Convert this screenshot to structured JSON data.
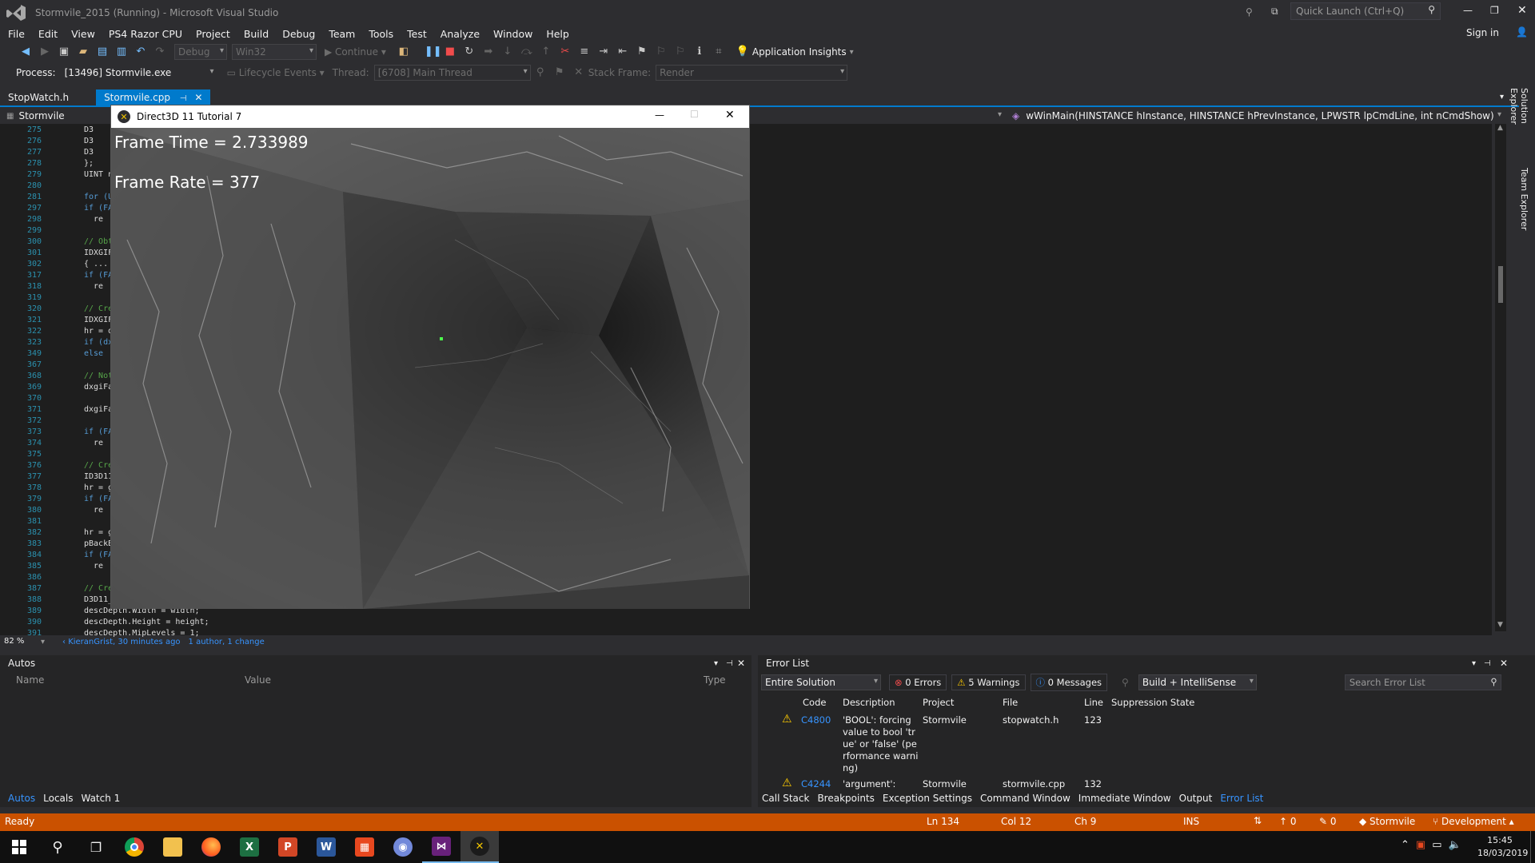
{
  "window": {
    "title": "Stormvile_2015 (Running) - Microsoft Visual Studio",
    "quick_launch": "Quick Launch (Ctrl+Q)",
    "sign_in": "Sign in"
  },
  "menu": [
    "File",
    "Edit",
    "View",
    "PS4 Razor CPU",
    "Project",
    "Build",
    "Debug",
    "Team",
    "Tools",
    "Test",
    "Analyze",
    "Window",
    "Help"
  ],
  "toolbar": {
    "config": "Debug",
    "platform": "Win32",
    "continue": "Continue",
    "app_insights": "Application Insights"
  },
  "debugbar": {
    "process_label": "Process:",
    "process": "[13496] Stormvile.exe",
    "lifecycle": "Lifecycle Events",
    "thread_label": "Thread:",
    "thread": "[6708] Main Thread",
    "stack_label": "Stack Frame:",
    "stack": "Render"
  },
  "tabs": [
    {
      "label": "StopWatch.h"
    },
    {
      "label": "Stormvile.cpp"
    }
  ],
  "nav": {
    "project": "Stormvile",
    "function": "wWinMain(HINSTANCE hInstance, HINSTANCE hPrevInstance, LPWSTR lpCmdLine, int nCmdShow)"
  },
  "side_tabs": [
    "Solution Explorer",
    "Team Explorer"
  ],
  "editor": {
    "lines": [
      {
        "n": "275",
        "c": "D3"
      },
      {
        "n": "276",
        "c": "D3"
      },
      {
        "n": "277",
        "c": "D3"
      },
      {
        "n": "278",
        "c": "};"
      },
      {
        "n": "279",
        "c": "UINT n"
      },
      {
        "n": "280",
        "c": ""
      },
      {
        "n": "281",
        "c": "for (U"
      },
      {
        "n": "297",
        "c": "if (FA"
      },
      {
        "n": "298",
        "c": "  re"
      },
      {
        "n": "299",
        "c": ""
      },
      {
        "n": "300",
        "c": "// Obt"
      },
      {
        "n": "301",
        "c": "IDXGIF"
      },
      {
        "n": "302",
        "c": "{ ..."
      },
      {
        "n": "317",
        "c": "if (FA"
      },
      {
        "n": "318",
        "c": "  re"
      },
      {
        "n": "319",
        "c": ""
      },
      {
        "n": "320",
        "c": "// Cre"
      },
      {
        "n": "321",
        "c": "IDXGIF"
      },
      {
        "n": "322",
        "c": "hr = d"
      },
      {
        "n": "323",
        "c": "if (dx"
      },
      {
        "n": "349",
        "c": "else"
      },
      {
        "n": "367",
        "c": ""
      },
      {
        "n": "368",
        "c": "// Not"
      },
      {
        "n": "369",
        "c": "dxgiFa"
      },
      {
        "n": "370",
        "c": ""
      },
      {
        "n": "371",
        "c": "dxgiFa"
      },
      {
        "n": "372",
        "c": ""
      },
      {
        "n": "373",
        "c": "if (FA"
      },
      {
        "n": "374",
        "c": "  re"
      },
      {
        "n": "375",
        "c": ""
      },
      {
        "n": "376",
        "c": "// Cre"
      },
      {
        "n": "377",
        "c": "ID3D11"
      },
      {
        "n": "378",
        "c": "hr = g"
      },
      {
        "n": "379",
        "c": "if (FA"
      },
      {
        "n": "380",
        "c": "  re"
      },
      {
        "n": "381",
        "c": ""
      },
      {
        "n": "382",
        "c": "hr = g"
      },
      {
        "n": "383",
        "c": "pBackB"
      },
      {
        "n": "384",
        "c": "if (FA"
      },
      {
        "n": "385",
        "c": "  re"
      },
      {
        "n": "386",
        "c": ""
      },
      {
        "n": "387",
        "c": "// Cre"
      },
      {
        "n": "388",
        "c": "D3D11_"
      },
      {
        "n": "389",
        "c": "descDepth.Width = width;"
      },
      {
        "n": "390",
        "c": "descDepth.Height = height;"
      },
      {
        "n": "391",
        "c": "descDepth.MipLevels = 1;"
      }
    ],
    "zoom": "82 %",
    "codelens_author": "KieranGrist, 30 minutes ago",
    "codelens_changes": "1 author, 1 change"
  },
  "dx_window": {
    "title": "Direct3D 11 Tutorial 7",
    "frame_time": "Frame Time = 2.733989",
    "frame_rate": "Frame Rate = 377"
  },
  "autos": {
    "title": "Autos",
    "col_name": "Name",
    "col_value": "Value",
    "col_type": "Type"
  },
  "error_list": {
    "title": "Error List",
    "scope": "Entire Solution",
    "errors": "0 Errors",
    "warnings": "5 Warnings",
    "messages": "0 Messages",
    "build_filter": "Build + IntelliSense",
    "search": "Search Error List",
    "cols": [
      "Code",
      "Description",
      "Project",
      "File",
      "Line",
      "Suppression State"
    ],
    "rows": [
      {
        "code": "C4800",
        "desc": "'BOOL': forcing value to bool 'true' or 'false' (performance warning)",
        "project": "Stormvile",
        "file": "stopwatch.h",
        "line": "123"
      },
      {
        "code": "C4244",
        "desc": "'argument':",
        "project": "Stormvile",
        "file": "stormvile.cpp",
        "line": "132"
      }
    ]
  },
  "bottom_tabs_left": [
    "Autos",
    "Locals",
    "Watch 1"
  ],
  "bottom_tabs_right": [
    "Call Stack",
    "Breakpoints",
    "Exception Settings",
    "Command Window",
    "Immediate Window",
    "Output",
    "Error List"
  ],
  "status": {
    "ready": "Ready",
    "ln": "Ln 134",
    "col": "Col 12",
    "ch": "Ch 9",
    "ins": "INS",
    "up": "0",
    "pencil": "0",
    "repo": "Stormvile",
    "branch": "Development"
  },
  "taskbar": {
    "time": "15:45",
    "date": "18/03/2019",
    "apps": [
      "chrome-icon",
      "folder-icon",
      "firefox-icon",
      "excel-icon",
      "powerpoint-icon",
      "word-icon",
      "app-icon",
      "discord-icon",
      "visual-studio-icon",
      "directx-app-icon"
    ]
  },
  "colors": {
    "accent": "#007acc",
    "status": "#ca5100",
    "editor_bg": "#1e1e1e"
  }
}
